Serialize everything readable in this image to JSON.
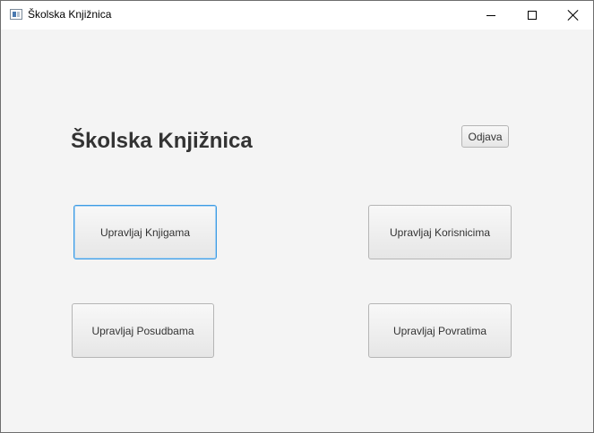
{
  "window": {
    "title": "Školska Knjižnica",
    "controls": {
      "minimize_icon": "minimize-icon",
      "maximize_icon": "maximize-icon",
      "close_icon": "close-icon"
    }
  },
  "main": {
    "heading": "Školska Knjižnica",
    "logout_label": "Odjava",
    "buttons": [
      {
        "label": "Upravljaj Knjigama",
        "focused": true
      },
      {
        "label": "Upravljaj Korisnicima",
        "focused": false
      },
      {
        "label": "Upravljaj Posudbama",
        "focused": false
      },
      {
        "label": "Upravljaj Povratima",
        "focused": false
      }
    ]
  },
  "colors": {
    "background": "#f4f4f4",
    "focus_border": "#3c9be3",
    "text": "#333333"
  }
}
